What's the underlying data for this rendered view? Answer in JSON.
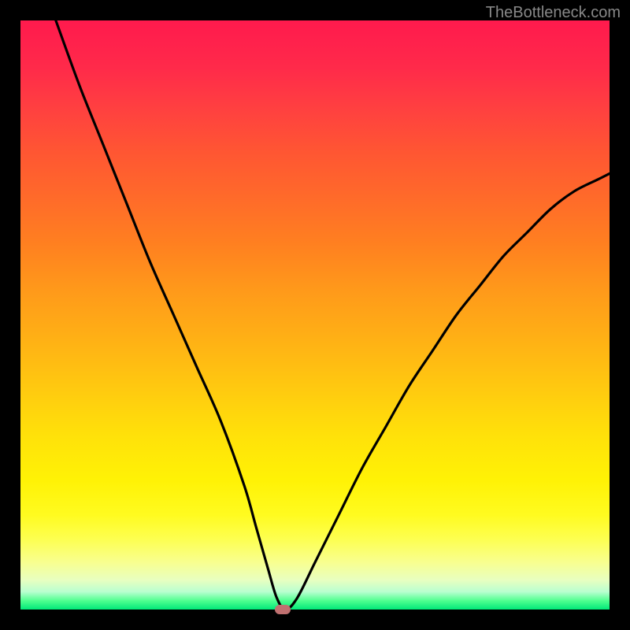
{
  "watermark": "TheBottleneck.com",
  "chart_data": {
    "type": "line",
    "title": "",
    "xlabel": "",
    "ylabel": "",
    "xlim": [
      0,
      100
    ],
    "ylim": [
      0,
      100
    ],
    "grid": false,
    "legend": false,
    "background_gradient": {
      "top": "#ff1a4d",
      "middle": "#ffe00a",
      "bottom": "#00e878"
    },
    "series": [
      {
        "name": "bottleneck-curve",
        "color": "#000000",
        "x": [
          6,
          10,
          14,
          18,
          22,
          26,
          30,
          34,
          38,
          40,
          42,
          43.5,
          45,
          47,
          50,
          54,
          58,
          62,
          66,
          70,
          74,
          78,
          82,
          86,
          90,
          94,
          98,
          100
        ],
        "y": [
          100,
          89,
          79,
          69,
          59,
          50,
          41,
          32,
          21,
          14,
          7,
          2,
          0,
          2,
          8,
          16,
          24,
          31,
          38,
          44,
          50,
          55,
          60,
          64,
          68,
          71,
          73,
          74
        ]
      }
    ],
    "markers": [
      {
        "name": "optimal-point",
        "x": 44.5,
        "y": 0,
        "color": "#c07070"
      }
    ]
  }
}
